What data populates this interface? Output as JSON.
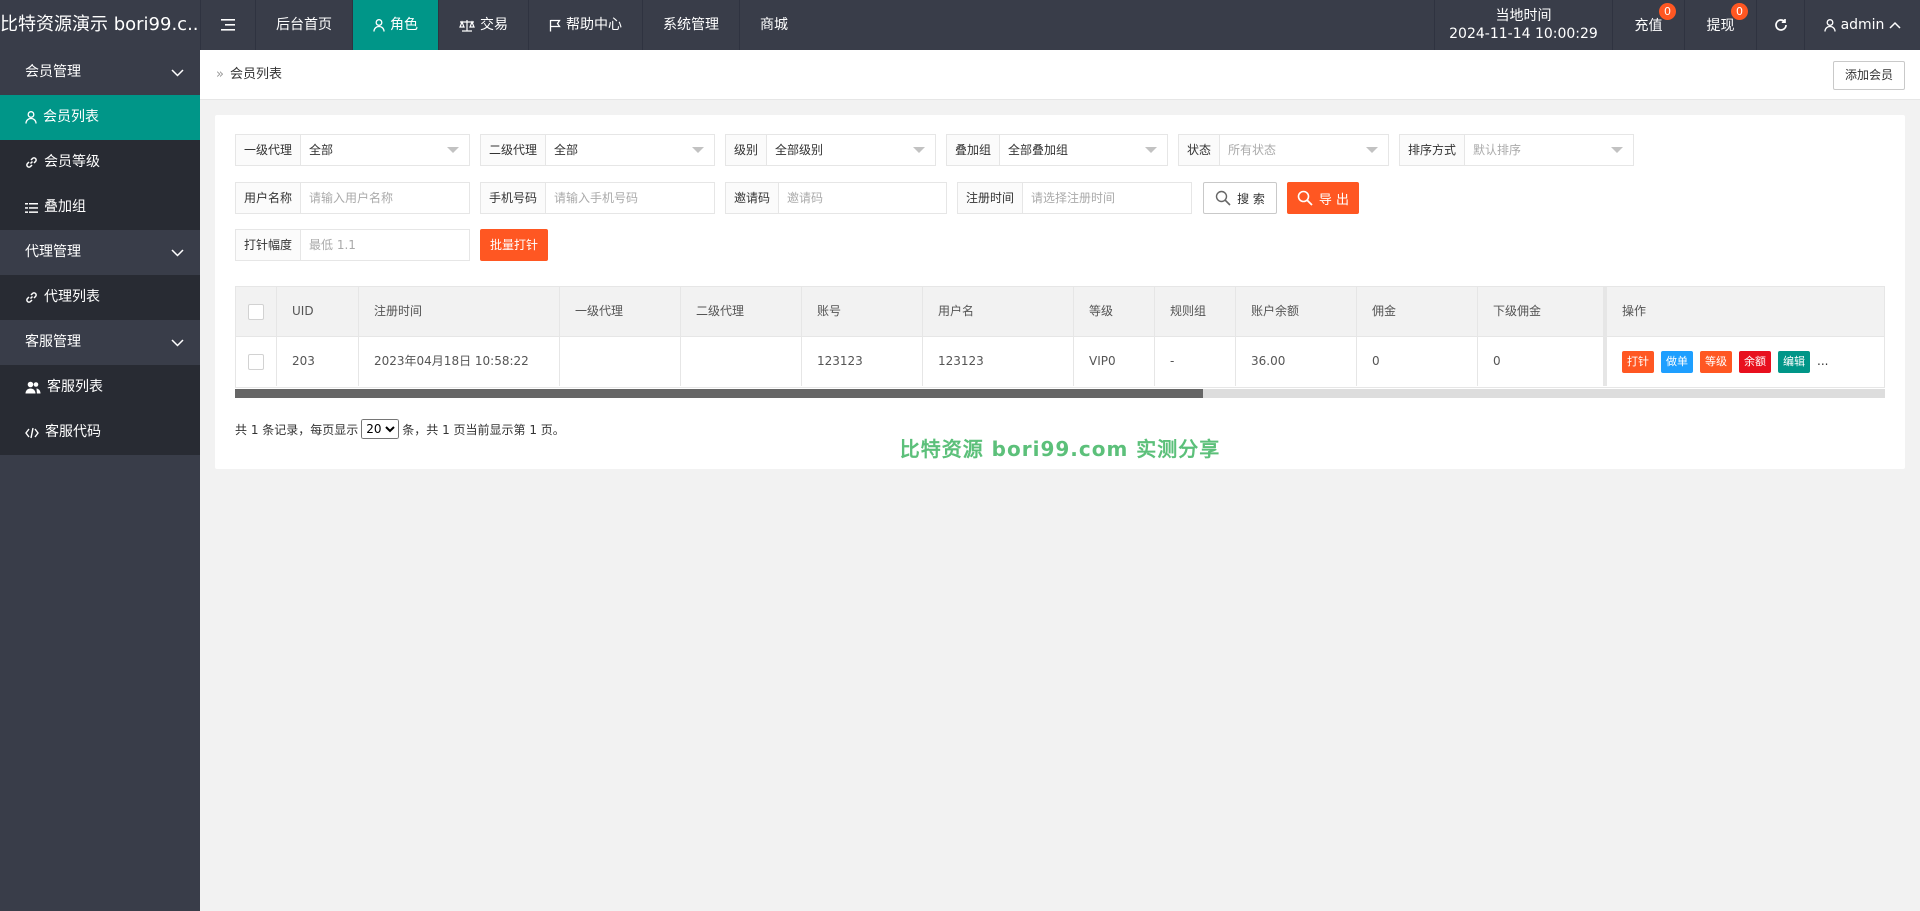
{
  "header": {
    "logo": "比特资源演示 bori99.c...",
    "nav": [
      {
        "label": "后台首页"
      },
      {
        "label": "角色"
      },
      {
        "label": "交易"
      },
      {
        "label": "帮助中心"
      },
      {
        "label": "系统管理"
      },
      {
        "label": "商城"
      }
    ],
    "time_label": "当地时间",
    "time_value": "2024-11-14 10:00:29",
    "recharge": {
      "label": "充值",
      "badge": "0"
    },
    "withdraw": {
      "label": "提现",
      "badge": "0"
    },
    "user": "admin"
  },
  "sidebar": {
    "groups": [
      {
        "label": "会员管理",
        "items": [
          {
            "label": "会员列表"
          },
          {
            "label": "会员等级"
          },
          {
            "label": "叠加组"
          }
        ]
      },
      {
        "label": "代理管理",
        "items": [
          {
            "label": "代理列表"
          }
        ]
      },
      {
        "label": "客服管理",
        "items": [
          {
            "label": "客服列表"
          },
          {
            "label": "客服代码"
          }
        ]
      }
    ]
  },
  "breadcrumb": {
    "label": "会员列表",
    "add_button": "添加会员"
  },
  "filters": {
    "agent1": {
      "label": "一级代理",
      "value": "全部"
    },
    "agent2": {
      "label": "二级代理",
      "value": "全部"
    },
    "level": {
      "label": "级别",
      "value": "全部级别"
    },
    "group": {
      "label": "叠加组",
      "value": "全部叠加组"
    },
    "status": {
      "label": "状态",
      "value": "所有状态"
    },
    "sort": {
      "label": "排序方式",
      "value": "默认排序"
    },
    "username": {
      "label": "用户名称",
      "placeholder": "请输入用户名称"
    },
    "phone": {
      "label": "手机号码",
      "placeholder": "请输入手机号码"
    },
    "invite": {
      "label": "邀请码",
      "placeholder": "邀请码"
    },
    "regtime": {
      "label": "注册时间",
      "placeholder": "请选择注册时间"
    },
    "search_button": "搜 索",
    "export_button": "导 出",
    "amplitude": {
      "label": "打针幅度",
      "placeholder": "最低 1.1"
    },
    "batch_button": "批量打针"
  },
  "table": {
    "columns": [
      "UID",
      "注册时间",
      "一级代理",
      "二级代理",
      "账号",
      "用户名",
      "等级",
      "规则组",
      "账户余额",
      "佣金",
      "下级佣金",
      "操作"
    ],
    "rows": [
      {
        "uid": "203",
        "regtime": "2023年04月18日 10:58:22",
        "agent1": "",
        "agent2": "",
        "account": "123123",
        "username": "123123",
        "level": "VIP0",
        "rule": "-",
        "balance": "36.00",
        "commission": "0",
        "sub_commission": "0"
      }
    ],
    "actions": [
      {
        "label": "打针",
        "color": "#ff5722"
      },
      {
        "label": "做单",
        "color": "#1e9fff"
      },
      {
        "label": "等级",
        "color": "#ff5722"
      },
      {
        "label": "余额",
        "color": "#e8101e"
      },
      {
        "label": "编辑",
        "color": "#009688"
      }
    ],
    "more": "..."
  },
  "pager": {
    "prefix": "共 1 条记录，每页显示",
    "page_size": "20",
    "suffix": "条，共 1 页当前显示第 1 页。"
  },
  "watermark": "比特资源 bori99.com 实测分享",
  "colors": {
    "header": "#393d49",
    "accent": "#009688",
    "danger": "#ff5722"
  }
}
